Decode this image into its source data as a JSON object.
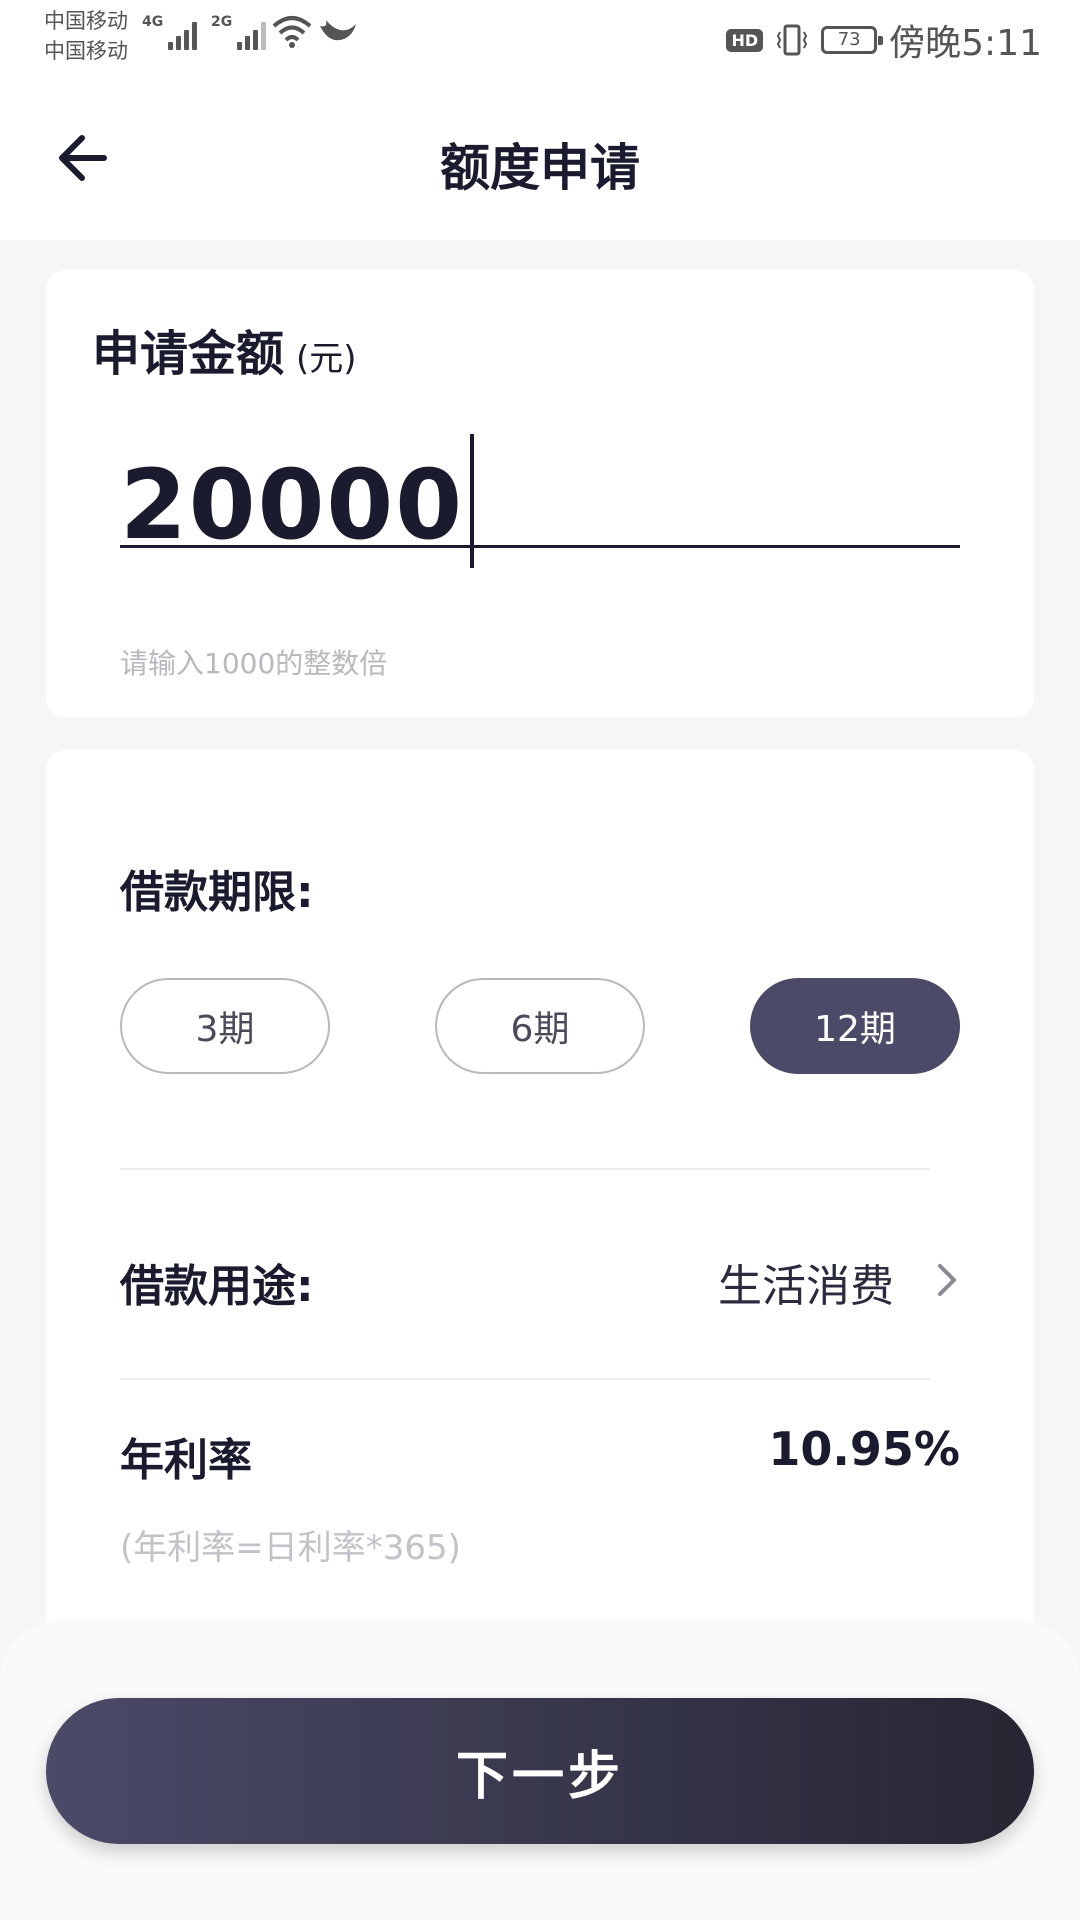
{
  "status_bar": {
    "carrier_1": "中国移动",
    "carrier_2": "中国移动",
    "network_1": "4G",
    "network_2": "2G",
    "hd_badge": "HD",
    "battery_level": "73",
    "time": "傍晚5:11",
    "icons": [
      "signal-icon",
      "wifi-icon",
      "bird-icon",
      "vibrate-icon",
      "battery-icon"
    ]
  },
  "header": {
    "title": "额度申请",
    "back_icon": "back-arrow-icon"
  },
  "amount_card": {
    "label": "申请金额",
    "unit": "(元)",
    "value": "20000",
    "hint": "请输入1000的整数倍"
  },
  "loan_card": {
    "term_label": "借款期限:",
    "terms": [
      "3期",
      "6期",
      "12期"
    ],
    "selected_term": "12期",
    "purpose_label": "借款用途:",
    "purpose_value": "生活消费",
    "rate_label": "年利率",
    "rate_value": "10.95%",
    "rate_note": "(年利率=日利率*365)"
  },
  "footer": {
    "next_label": "下一步"
  },
  "colors": {
    "primary": "#4b4a68",
    "primary_dark": "#262633",
    "text": "#1a1b2e",
    "hint": "#b8b8bf",
    "background": "#f6f6f8"
  }
}
